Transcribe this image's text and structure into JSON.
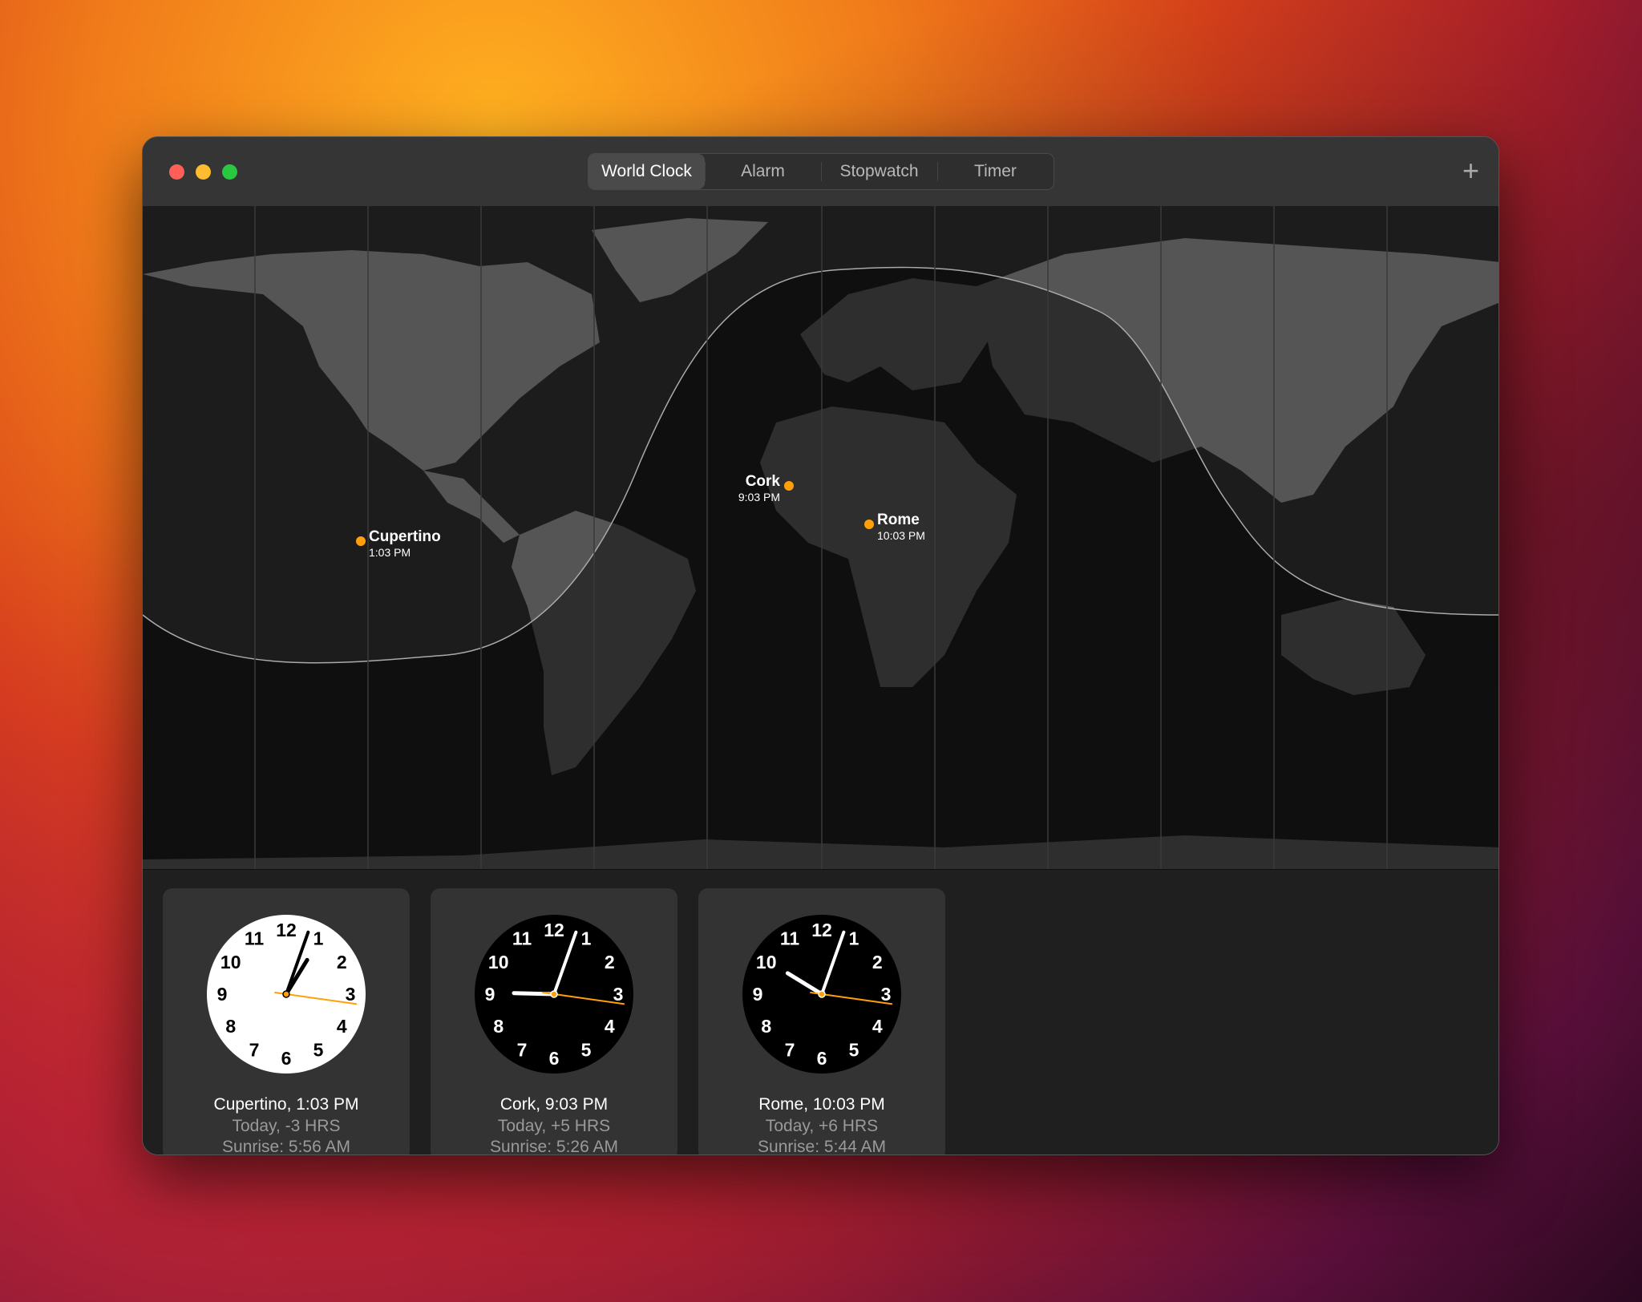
{
  "window": {
    "tabs": [
      {
        "label": "World Clock",
        "active": true
      },
      {
        "label": "Alarm",
        "active": false
      },
      {
        "label": "Stopwatch",
        "active": false
      },
      {
        "label": "Timer",
        "active": false
      }
    ],
    "add_label": "+"
  },
  "map": {
    "cities": [
      {
        "name": "Cupertino",
        "time": "1:03 PM"
      },
      {
        "name": "Cork",
        "time": "9:03 PM"
      },
      {
        "name": "Rome",
        "time": "10:03 PM"
      }
    ],
    "marker_color": "#ff9f0a"
  },
  "clocks": [
    {
      "title": "Cupertino, 1:03 PM",
      "diff": "Today, -3 HRS",
      "sunrise": "Sunrise: 5:56 AM",
      "hour": 13,
      "minute": 3,
      "second": 15,
      "face": "light"
    },
    {
      "title": "Cork, 9:03 PM",
      "diff": "Today, +5 HRS",
      "sunrise": "Sunrise: 5:26 AM",
      "hour": 21,
      "minute": 3,
      "second": 15,
      "face": "dark"
    },
    {
      "title": "Rome, 10:03 PM",
      "diff": "Today, +6 HRS",
      "sunrise": "Sunrise: 5:44 AM",
      "hour": 22,
      "minute": 3,
      "second": 15,
      "face": "dark"
    }
  ],
  "dial_numbers": [
    "12",
    "1",
    "2",
    "3",
    "4",
    "5",
    "6",
    "7",
    "8",
    "9",
    "10",
    "11"
  ]
}
